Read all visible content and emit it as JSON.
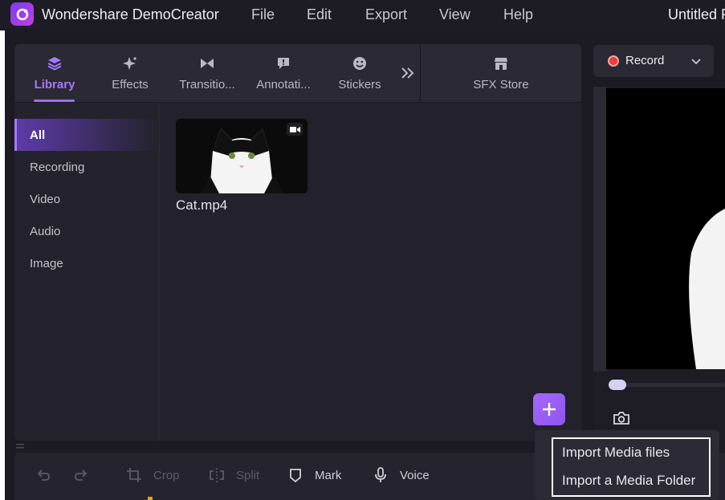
{
  "app": {
    "title": "Wondershare DemoCreator",
    "document_title": "Untitled P",
    "menus": [
      "File",
      "Edit",
      "Export",
      "View",
      "Help"
    ]
  },
  "library": {
    "tabs": [
      {
        "label": "Library",
        "icon": "layers-icon",
        "active": true
      },
      {
        "label": "Effects",
        "icon": "sparkle-icon",
        "active": false
      },
      {
        "label": "Transitio...",
        "icon": "bowtie-icon",
        "active": false
      },
      {
        "label": "Annotati...",
        "icon": "speech-bubble-icon",
        "active": false
      },
      {
        "label": "Stickers",
        "icon": "smiley-icon",
        "active": false
      }
    ],
    "store_label": "SFX Store",
    "sidebar": [
      "All",
      "Recording",
      "Video",
      "Audio",
      "Image"
    ],
    "active_sidebar": "All",
    "media": [
      {
        "name": "Cat.mp4",
        "type": "video"
      }
    ]
  },
  "record": {
    "label": "Record"
  },
  "toolbar": {
    "crop": "Crop",
    "split": "Split",
    "mark": "Mark",
    "voice": "Voice"
  },
  "import_menu": {
    "media_files": "Import Media files",
    "media_folder": "Import a Media Folder"
  },
  "colors": {
    "accent": "#9d6dff",
    "record": "#ee3b3b",
    "background": "#1c1b24"
  }
}
